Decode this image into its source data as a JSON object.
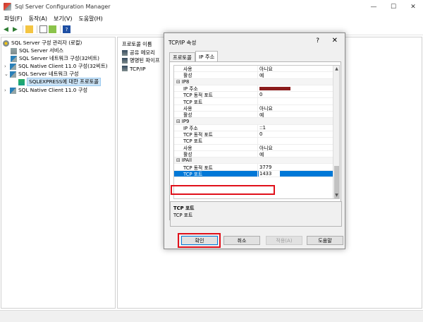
{
  "window": {
    "title": "Sql Server Configuration Manager"
  },
  "menu": [
    "파일(F)",
    "동작(A)",
    "보기(V)",
    "도움말(H)"
  ],
  "tree": [
    {
      "label": "SQL Server 구성 관리자 (로컬)",
      "icon": "gear-icon"
    },
    {
      "label": "SQL Server 서비스",
      "icon": "server-icon"
    },
    {
      "label": "SQL Server 네트워크 구성(32비트)",
      "icon": "network-icon"
    },
    {
      "label": "SQL Native Client 11.0 구성(32비트)",
      "icon": "network-icon",
      "expand": "›"
    },
    {
      "label": "SQL Server 네트워크 구성",
      "icon": "network-icon",
      "expand": "⌄"
    },
    {
      "label": "SQLEXPRESS에 대한 프로토콜",
      "icon": "protocol-icon",
      "selected": true
    },
    {
      "label": "SQL Native Client 11.0 구성",
      "icon": "network-icon",
      "expand": "›"
    }
  ],
  "list": {
    "header": "프로토콜 이름",
    "items": [
      "공유 메모리",
      "명명된 파이프",
      "TCP/IP"
    ]
  },
  "dialog": {
    "title": "TCP/IP 속성",
    "help": "?",
    "close": "✕",
    "tabs": [
      "프로토콜",
      "IP 주소"
    ],
    "active_tab": 1,
    "rows": [
      {
        "name": "사용",
        "value": "아니요"
      },
      {
        "name": "활성",
        "value": "예"
      },
      {
        "name": "IP8",
        "section": true
      },
      {
        "name": "IP 주소",
        "value": "",
        "redacted": true
      },
      {
        "name": "TCP 동적 포트",
        "value": "0"
      },
      {
        "name": "TCP 포트",
        "value": ""
      },
      {
        "name": "사용",
        "value": "아니요"
      },
      {
        "name": "활성",
        "value": "예"
      },
      {
        "name": "IP9",
        "section": true
      },
      {
        "name": "IP 주소",
        "value": "::1"
      },
      {
        "name": "TCP 동적 포트",
        "value": "0"
      },
      {
        "name": "TCP 포트",
        "value": ""
      },
      {
        "name": "사용",
        "value": "아니요"
      },
      {
        "name": "활성",
        "value": "예"
      },
      {
        "name": "IPAll",
        "section": true
      },
      {
        "name": "TCP 동적 포트",
        "value": "3779"
      },
      {
        "name": "TCP 포트",
        "value": "1433",
        "selected": true
      }
    ],
    "description": {
      "title": "TCP 포트",
      "text": "TCP 포트"
    },
    "buttons": {
      "ok": "확인",
      "cancel": "취소",
      "apply": "적용(A)",
      "help": "도움말"
    }
  },
  "colors": {
    "selection": "#0078d7",
    "highlight": "#e0101a"
  }
}
